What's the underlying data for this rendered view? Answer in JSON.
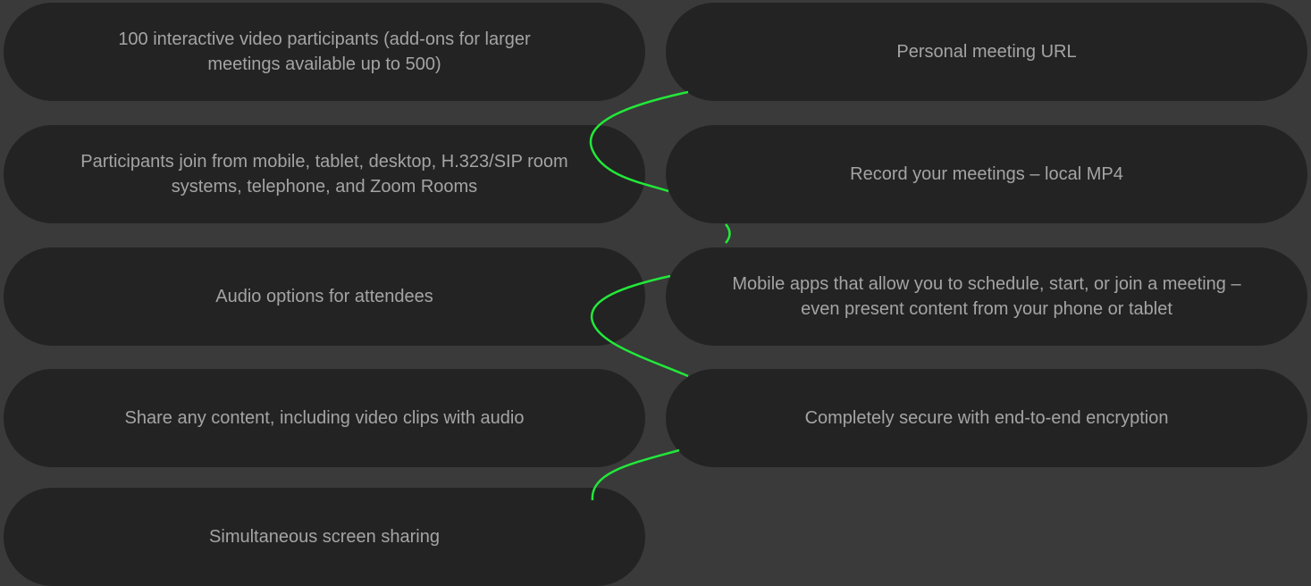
{
  "features": {
    "left": [
      {
        "label": "100 interactive video participants (add-ons for larger meetings available up to 500)"
      },
      {
        "label": "Participants join from mobile, tablet, desktop, H.323/SIP room systems, telephone, and Zoom Rooms"
      },
      {
        "label": "Audio options for attendees"
      },
      {
        "label": "Share any content, including video clips with audio"
      },
      {
        "label": "Simultaneous screen sharing"
      }
    ],
    "right": [
      {
        "label": "Personal meeting URL"
      },
      {
        "label": "Record your meetings – local MP4"
      },
      {
        "label": "Mobile apps that allow you to schedule, start, or join a meeting – even present content from your phone or tablet"
      },
      {
        "label": "Completely secure with end-to-end encryption"
      }
    ]
  },
  "colors": {
    "background": "#3a3a3a",
    "pill": "#232323",
    "text": "#a4a4a4",
    "connector": "#22e83a"
  }
}
